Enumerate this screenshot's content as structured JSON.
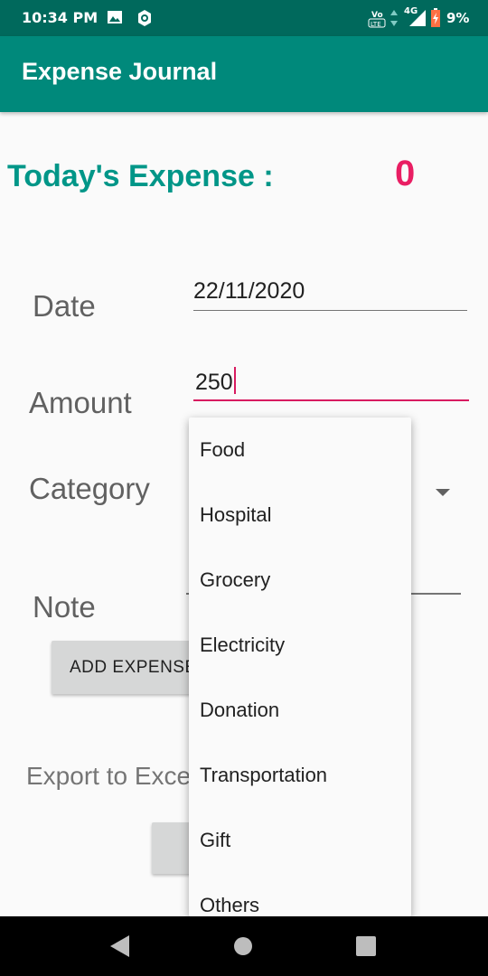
{
  "status_bar": {
    "time": "10:34 PM",
    "network": "4G",
    "battery": "9%",
    "icons": [
      "gallery-icon",
      "settings-icon",
      "volte-icon",
      "data-arrows-icon",
      "signal-icon",
      "battery-icon"
    ]
  },
  "app_bar": {
    "title": "Expense Journal",
    "color": "#00897b"
  },
  "summary": {
    "label": "Today's Expense :",
    "value": "0",
    "value_color": "#e91e63",
    "label_color": "#009688"
  },
  "form": {
    "date_label": "Date",
    "date_value": "22/11/2020",
    "amount_label": "Amount",
    "amount_value": "250",
    "category_label": "Category",
    "note_label": "Note",
    "add_button": "ADD EXPENSE",
    "export_label": "Export to Excel"
  },
  "category_dropdown": {
    "options": [
      "Food",
      "Hospital",
      "Grocery",
      "Electricity",
      "Donation",
      "Transportation",
      "Gift",
      "Others"
    ]
  },
  "nav_bar": {
    "icons": [
      "back-icon",
      "home-icon",
      "recents-icon"
    ]
  }
}
